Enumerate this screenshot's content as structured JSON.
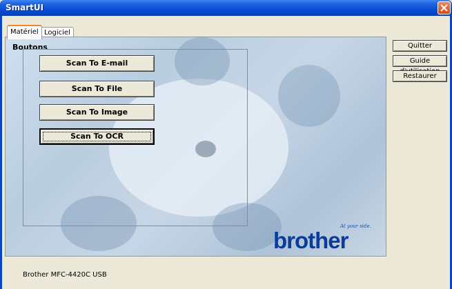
{
  "window": {
    "title": "SmartUI"
  },
  "tabs": [
    {
      "label": "Matériel",
      "active": true
    },
    {
      "label": "Logiciel",
      "active": false
    }
  ],
  "group": {
    "label": "Boutons",
    "buttons": [
      {
        "label": "Scan To E-mail",
        "focused": false
      },
      {
        "label": "Scan To File",
        "focused": false
      },
      {
        "label": "Scan To Image",
        "focused": false
      },
      {
        "label": "Scan To OCR",
        "focused": true
      }
    ]
  },
  "side_buttons": [
    {
      "label": "Quitter",
      "underline": "Q"
    },
    {
      "label": "Guide d'utilisation",
      "underline": "G"
    },
    {
      "label": "Restaurer",
      "underline": "R"
    }
  ],
  "logo": {
    "word": "brother",
    "tagline": "At your side."
  },
  "status": {
    "device": "Brother MFC-4420C USB"
  },
  "colors": {
    "titlebar": "#0845c4",
    "brand": "#0a3c9c",
    "tab_accent": "#e68b2c"
  },
  "icons": {
    "close": "close-icon"
  }
}
